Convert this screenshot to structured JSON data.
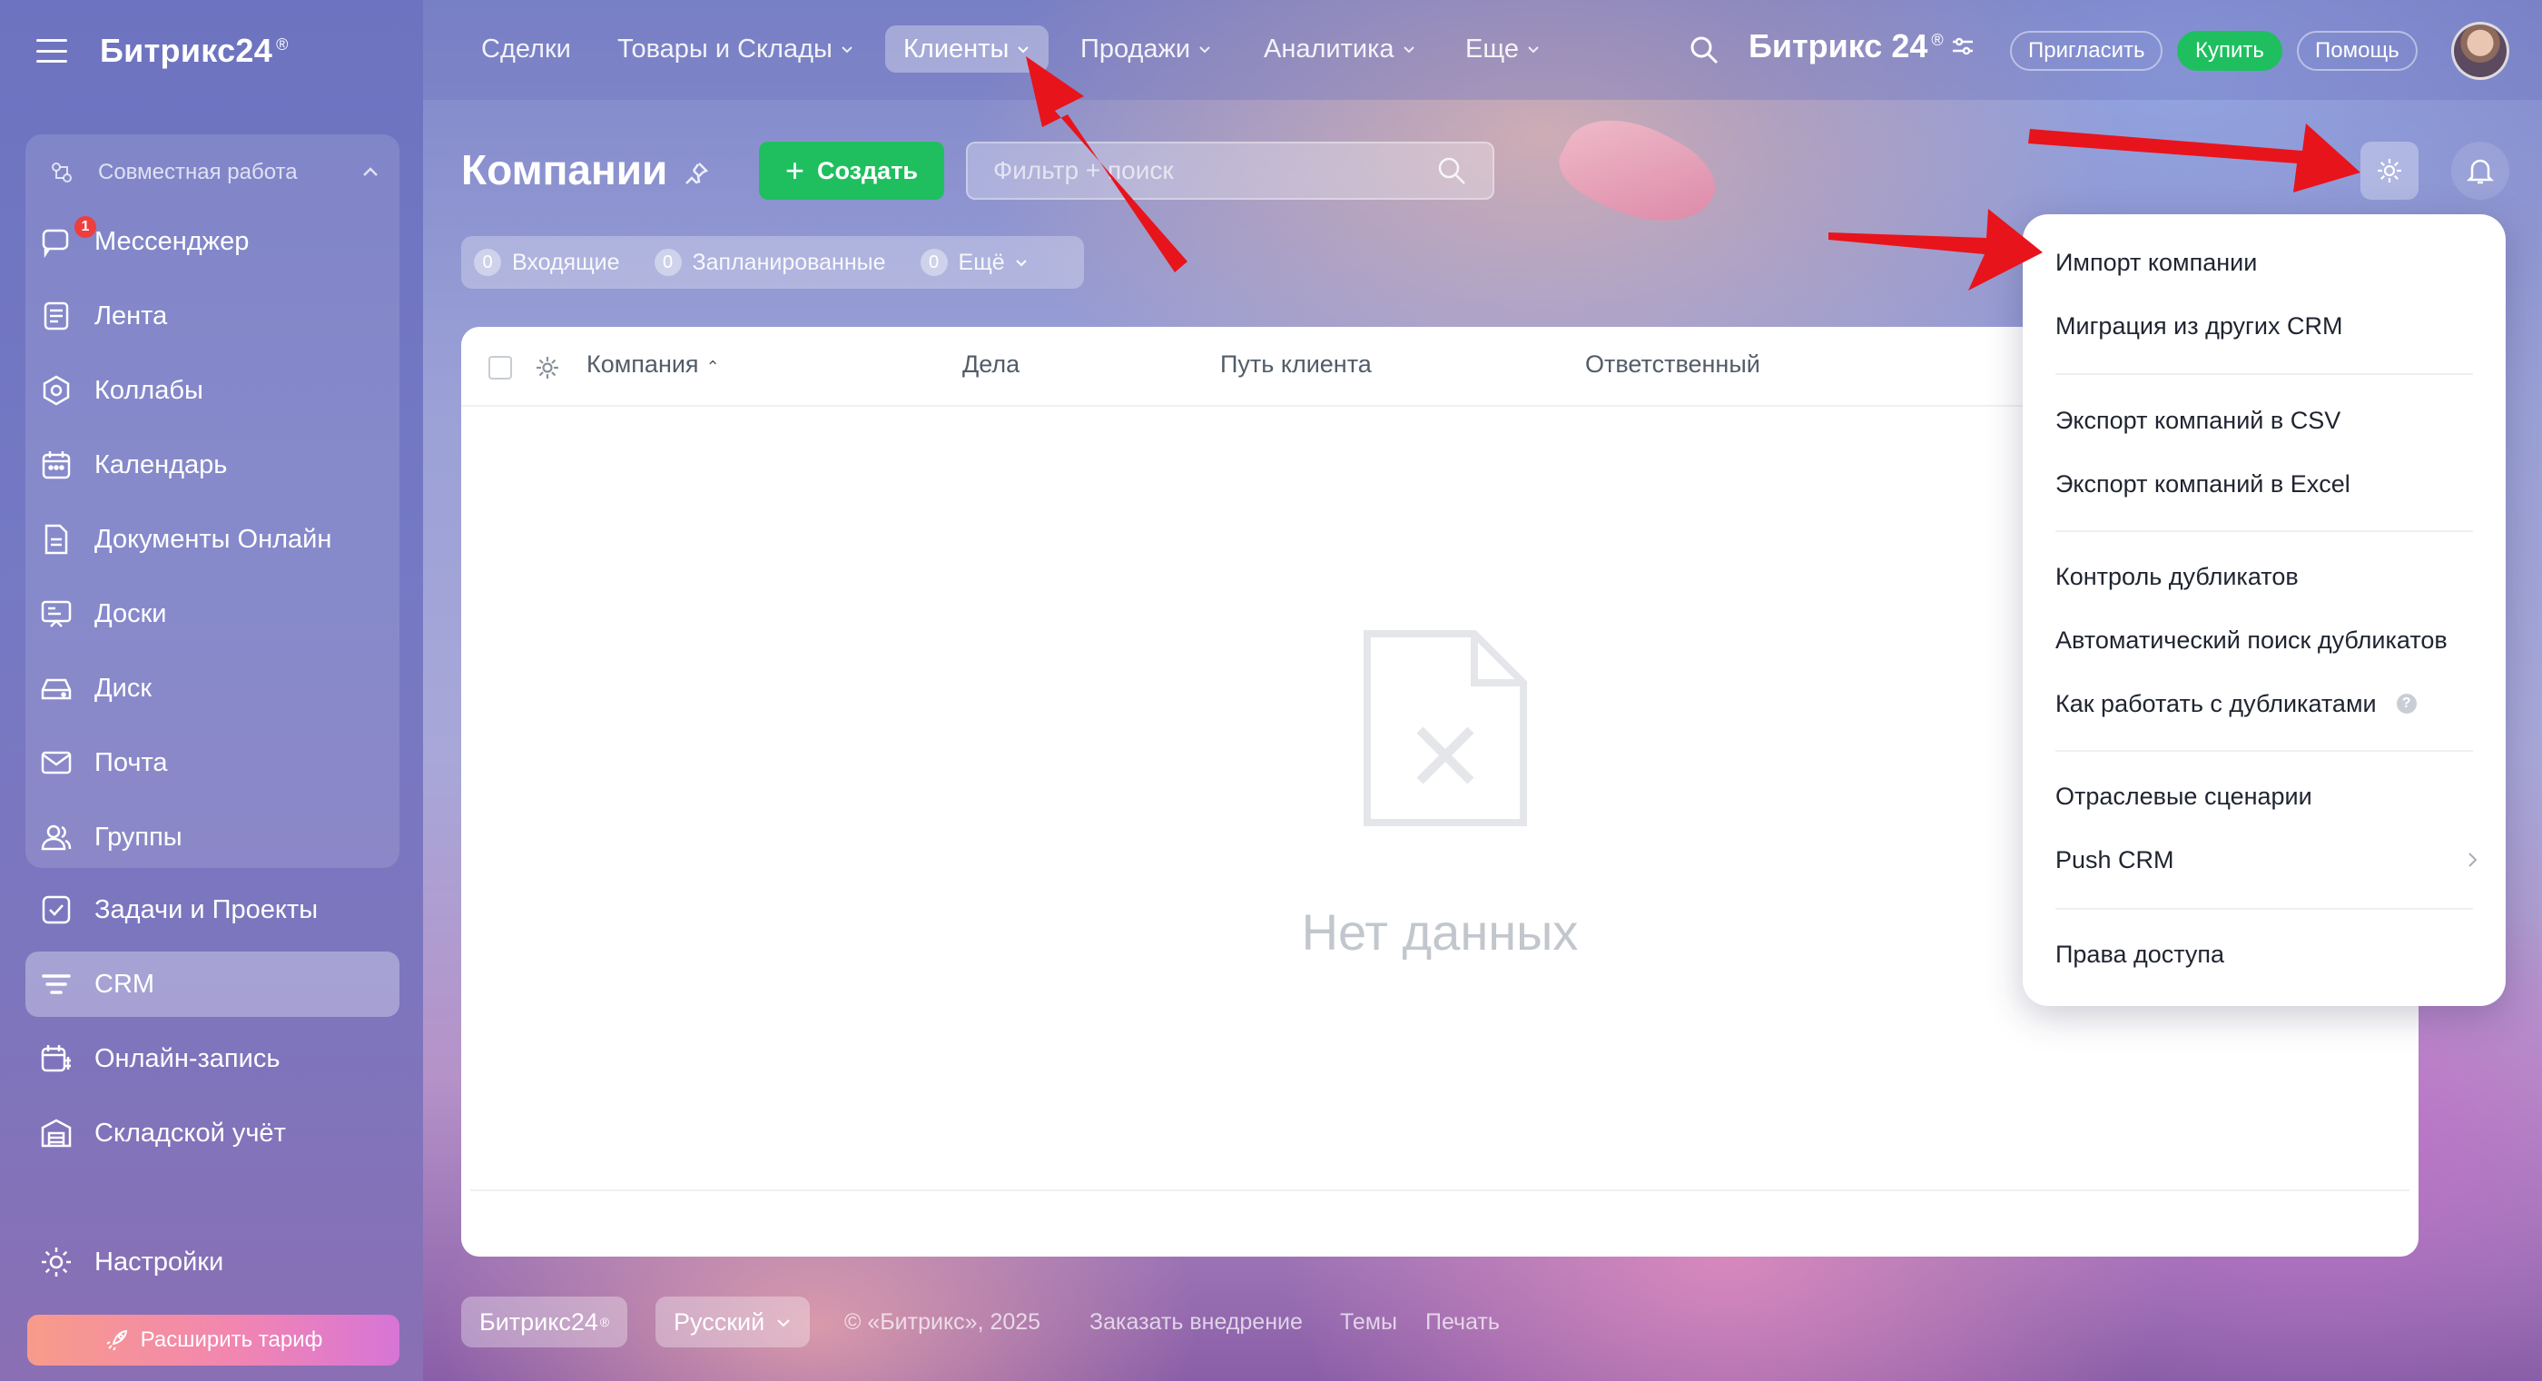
{
  "app": {
    "brand": "Битрикс24",
    "brand_mark": "®"
  },
  "sidebar": {
    "group_title": "Совместная работа",
    "items": [
      {
        "label": "Мессенджер",
        "badge": "1"
      },
      {
        "label": "Лента"
      },
      {
        "label": "Коллабы"
      },
      {
        "label": "Календарь"
      },
      {
        "label": "Документы Онлайн"
      },
      {
        "label": "Доски"
      },
      {
        "label": "Диск"
      },
      {
        "label": "Почта"
      },
      {
        "label": "Группы"
      }
    ],
    "items2": [
      {
        "label": "Задачи и Проекты"
      },
      {
        "label": "CRM",
        "active": true
      },
      {
        "label": "Онлайн-запись"
      },
      {
        "label": "Складской учёт"
      }
    ],
    "settings": "Настройки",
    "upgrade": "Расширить тариф"
  },
  "topnav": {
    "items": [
      {
        "label": "Сделки"
      },
      {
        "label": "Товары и Склады"
      },
      {
        "label": "Клиенты",
        "active": true
      },
      {
        "label": "Продажи"
      },
      {
        "label": "Аналитика"
      },
      {
        "label": "Еще"
      }
    ],
    "portal_name": "Битрикс 24",
    "invite": "Пригласить",
    "buy": "Купить",
    "help": "Помощь"
  },
  "toolbar": {
    "title": "Компании",
    "create": "Создать",
    "filter_placeholder": "Фильтр + поиск"
  },
  "counters": [
    {
      "num": "0",
      "label": "Входящие"
    },
    {
      "num": "0",
      "label": "Запланированные"
    },
    {
      "num": "0",
      "label": "Ещё"
    }
  ],
  "grid": {
    "columns": [
      "Компания",
      "Дела",
      "Путь клиента",
      "Ответственный"
    ],
    "empty": "Нет данных"
  },
  "menu": {
    "items": [
      "Импорт компании",
      "Миграция из других CRM",
      "Экспорт компаний в CSV",
      "Экспорт компаний в Excel",
      "Контроль дубликатов",
      "Автоматический поиск дубликатов",
      "Как работать с дубликатами",
      "Отраслевые сценарии",
      "Push CRM",
      "Права доступа"
    ],
    "help_symbol": "?"
  },
  "footer": {
    "brand": "Битрикс24",
    "language": "Русский",
    "copyright": "© «Битрикс», 2025",
    "order": "Заказать внедрение",
    "themes": "Темы",
    "print": "Печать"
  },
  "colors": {
    "accent_green": "#1fbf5f",
    "arrow_red": "#e8141c",
    "badge_red": "#ef3e3e"
  }
}
